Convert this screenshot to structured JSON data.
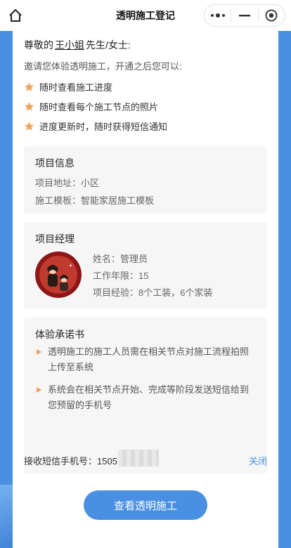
{
  "nav": {
    "title": "透明施工登记",
    "home_icon": "home-icon",
    "menu_icon": "more-dots-icon",
    "minimize_icon": "minimize-icon",
    "close_icon": "target-circle-icon"
  },
  "greeting": {
    "prefix": "尊敬的",
    "name": "王小姐",
    "suffix": "先生/女士:"
  },
  "invite_text": "邀请您体验透明施工，开通之后您可以:",
  "features": [
    "随时查看施工进度",
    "随时查看每个施工节点的照片",
    "进度更新时，随时获得短信通知"
  ],
  "project": {
    "title": "项目信息",
    "address": "项目地址：小区",
    "template": "施工模板：智能家居施工模板"
  },
  "manager": {
    "title": "项目经理",
    "name": "姓名：管理员",
    "years": "工作年限：15",
    "experience": "项目经验：8个工装，6个家装"
  },
  "commitment": {
    "title": "体验承诺书",
    "items": [
      "透明施工的施工人员需在相关节点对施工流程拍照上传至系统",
      "系统会在相关节点开始、完成等阶段发送短信给到您预留的手机号"
    ],
    "phone_label": "接收短信手机号：15051",
    "close_label": "关闭"
  },
  "cta_label": "查看透明施工",
  "colors": {
    "accent": "#4a90e2",
    "star": "#f0a25a",
    "panel_bg": "#f6f6f6"
  }
}
